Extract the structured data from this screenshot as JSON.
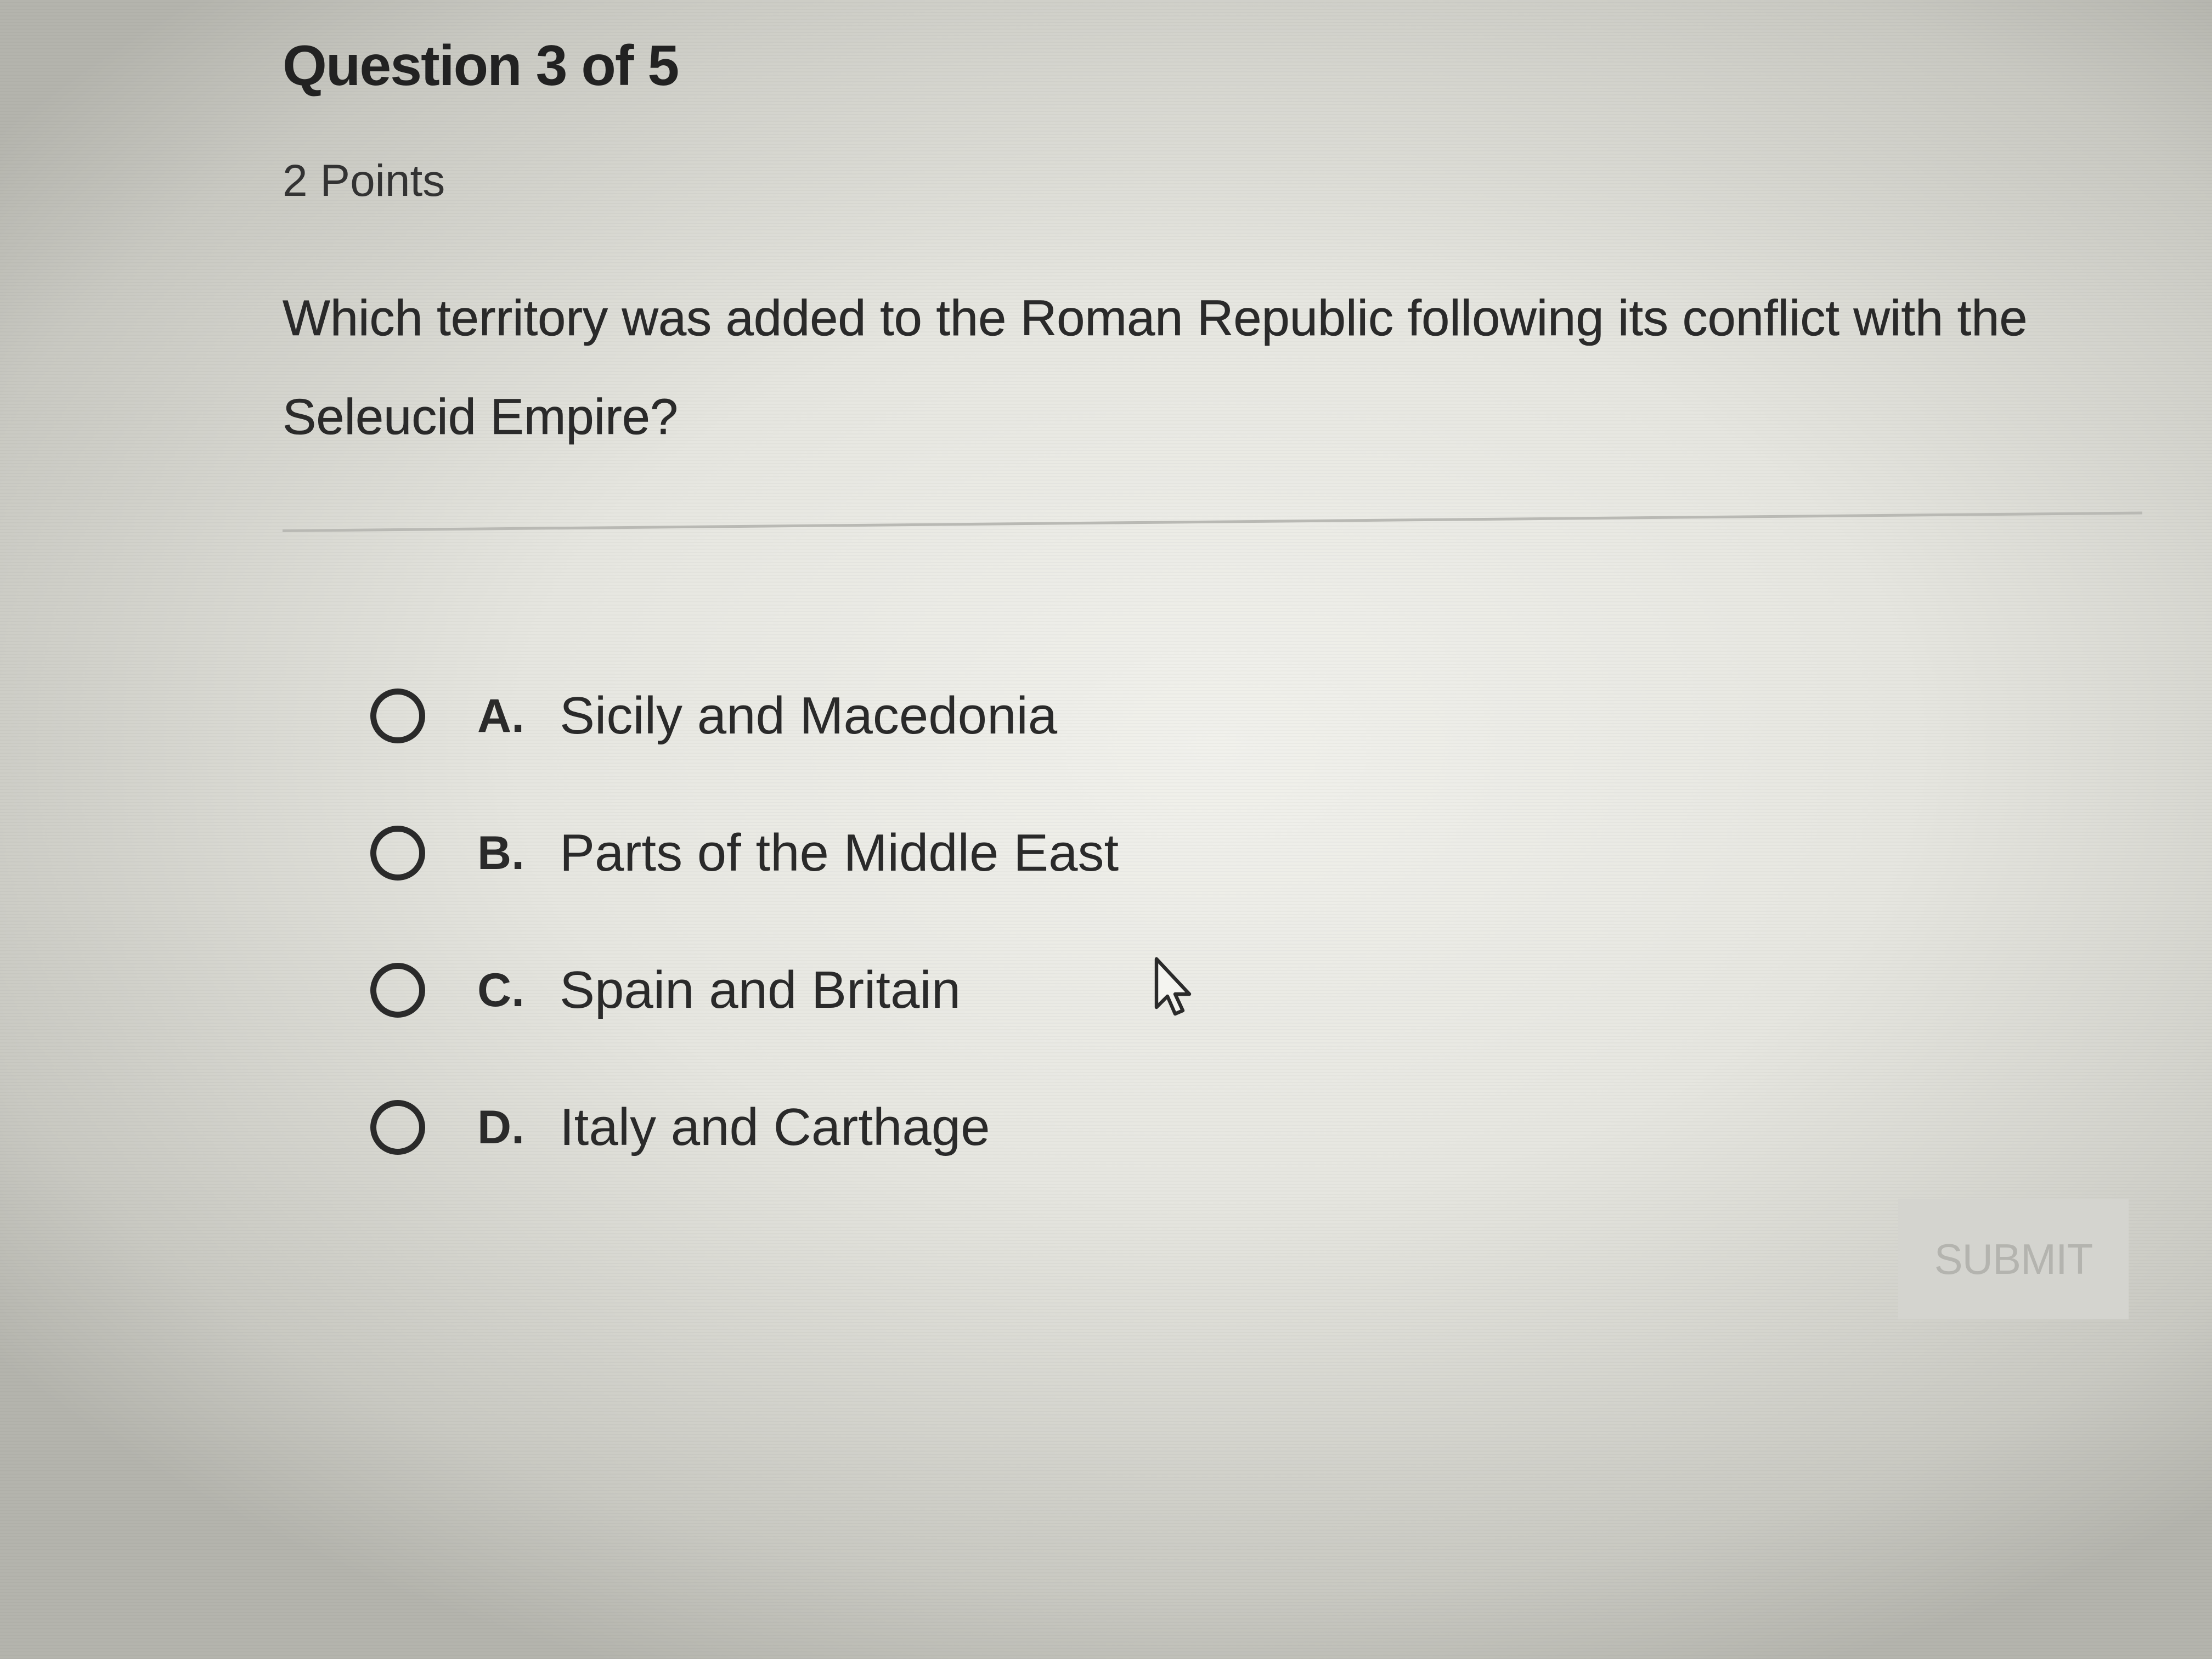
{
  "quiz": {
    "header": "Question 3 of 5",
    "points": "2 Points",
    "question": "Which territory was added to the Roman Republic following its conflict with the Seleucid Empire?",
    "options": [
      {
        "letter": "A.",
        "text": "Sicily and Macedonia"
      },
      {
        "letter": "B.",
        "text": "Parts of the Middle East"
      },
      {
        "letter": "C.",
        "text": "Spain and Britain"
      },
      {
        "letter": "D.",
        "text": "Italy and Carthage"
      }
    ],
    "submit_label": "SUBMIT"
  },
  "icons": {
    "radio": "radio-circle-icon",
    "cursor": "mouse-pointer-icon"
  },
  "colors": {
    "text": "#2a2a2a",
    "submit_bg": "#d4d4cf",
    "submit_text": "#b4b4af",
    "divider": "#b9b9b4"
  }
}
